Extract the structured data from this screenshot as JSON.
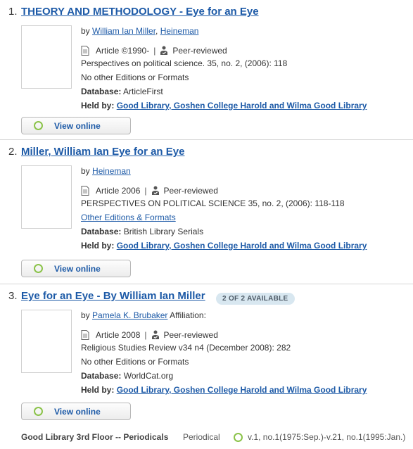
{
  "results": [
    {
      "number": "1.",
      "title": "THEORY AND METHODOLOGY - Eye for an Eye",
      "by_label": "by",
      "authors": [
        "William Ian Miller",
        "Heineman"
      ],
      "format": "Article",
      "date": "©1990-",
      "peer": "Peer-reviewed",
      "source": "Perspectives on political science. 35, no. 2, (2006): 118",
      "editions": "No other Editions or Formats",
      "database_label": "Database:",
      "database": "ArticleFirst",
      "held_label": "Held by:",
      "held_by": "Good Library, Goshen College Harold and Wilma Good Library",
      "button": "View online"
    },
    {
      "number": "2.",
      "title": "Miller, William Ian Eye for an Eye",
      "by_label": "by",
      "authors": [
        "Heineman"
      ],
      "format": "Article",
      "date": "2006",
      "peer": "Peer-reviewed",
      "source": "PERSPECTIVES ON POLITICAL SCIENCE 35, no. 2, (2006): 118-118",
      "editions": "Other Editions & Formats",
      "database_label": "Database:",
      "database": "British Library Serials",
      "held_label": "Held by:",
      "held_by": "Good Library, Goshen College Harold and Wilma Good Library",
      "button": "View online"
    },
    {
      "number": "3.",
      "title": "Eye for an Eye - By William Ian Miller",
      "badge": "2 OF 2 AVAILABLE",
      "by_label": "by",
      "authors": [
        "Pamela K. Brubaker"
      ],
      "affiliation": "Affiliation:",
      "format": "Article",
      "date": "2008",
      "peer": "Peer-reviewed",
      "source": "Religious Studies Review v34 n4 (December 2008): 282",
      "editions": "No other Editions or Formats",
      "database_label": "Database:",
      "database": "WorldCat.org",
      "held_label": "Held by:",
      "held_by": "Good Library, Goshen College Harold and Wilma Good Library",
      "button": "View online",
      "holding": {
        "location": "Good Library 3rd Floor -- Periodicals",
        "type": "Periodical",
        "coverage": "v.1, no.1(1975:Sep.)-v.21, no.1(1995:Jan.)"
      }
    }
  ],
  "colors": {
    "link": "#1d5aa7",
    "available": "#8bc34a",
    "badge_bg": "#d8e7f0"
  },
  "icons": {
    "format": "document-icon",
    "peer": "peer-reviewed-icon",
    "online": "available-circle-icon"
  }
}
